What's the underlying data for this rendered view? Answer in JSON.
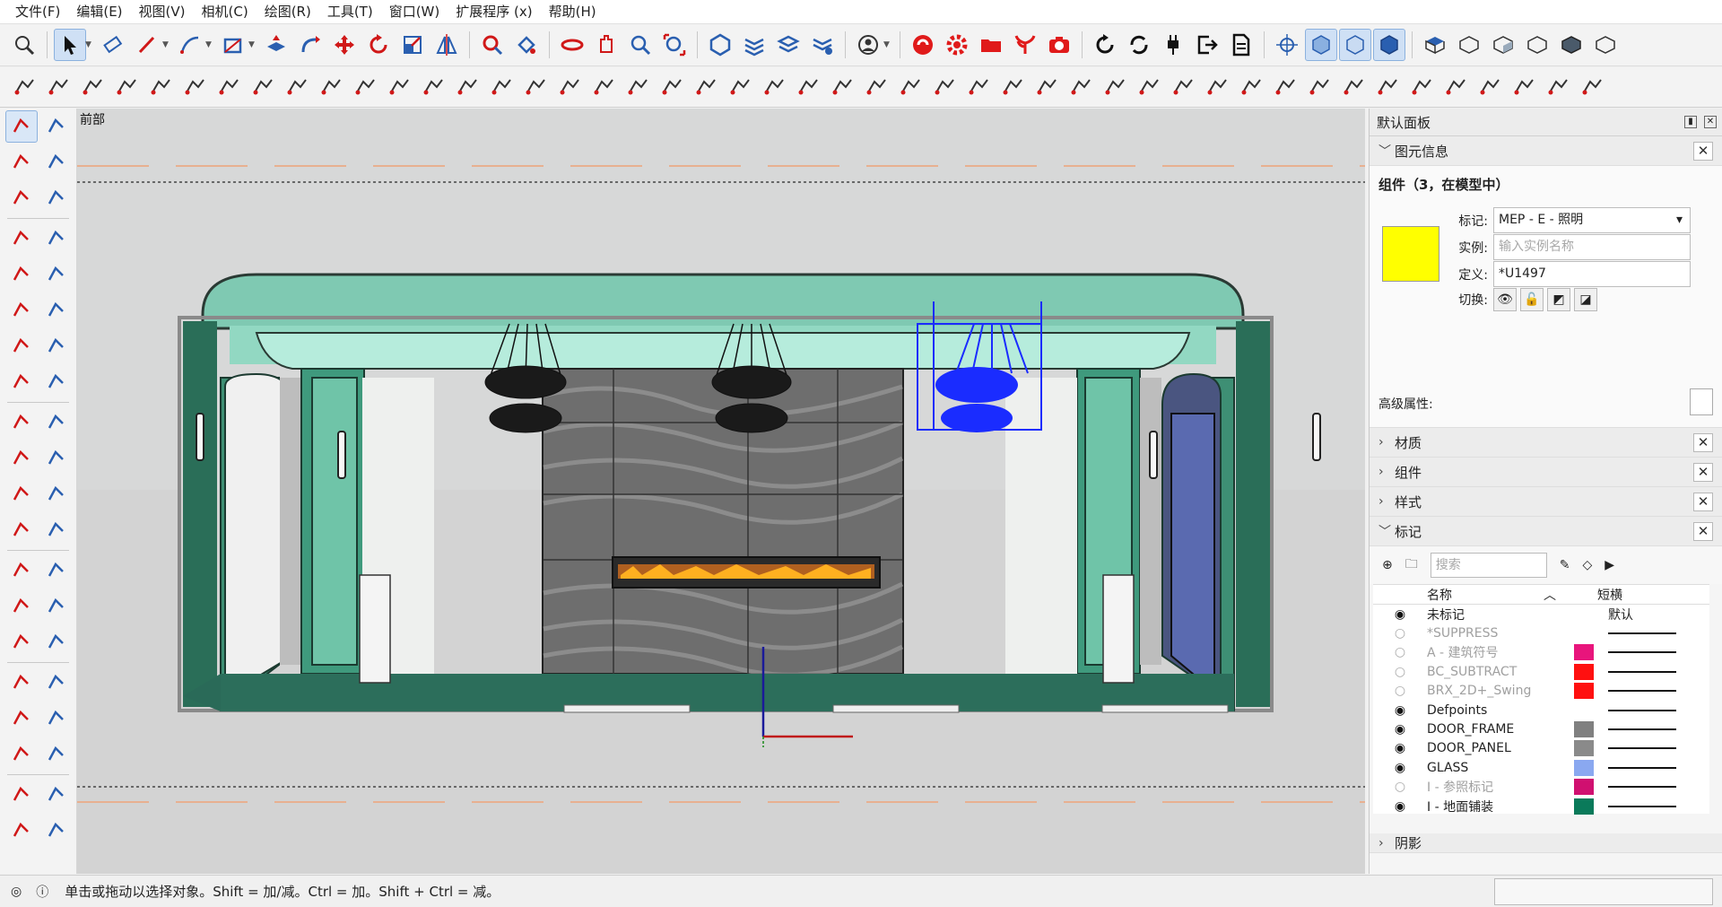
{
  "menu": [
    "文件(F)",
    "编辑(E)",
    "视图(V)",
    "相机(C)",
    "绘图(R)",
    "工具(T)",
    "窗口(W)",
    "扩展程序 (x)",
    "帮助(H)"
  ],
  "scene": {
    "label": "前部"
  },
  "tray": {
    "title": "默认面板",
    "entity_info": {
      "header": "图元信息",
      "title": "组件（3，在模型中）",
      "swatch_color": "#ffff00",
      "tag_label": "标记:",
      "tag_value": "MEP - E - 照明",
      "instance_label": "实例:",
      "instance_placeholder": "输入实例名称",
      "definition_label": "定义:",
      "definition_value": "*U1497",
      "toggle_label": "切换:",
      "advanced_label": "高级属性:"
    },
    "sections": [
      "材质",
      "组件",
      "样式"
    ],
    "tags": {
      "header": "标记",
      "search_placeholder": "搜索",
      "col_name": "名称",
      "col_dash": "短横",
      "rows": [
        {
          "name": "未标记",
          "visible": true,
          "dim": false,
          "color": "",
          "dash": "默认"
        },
        {
          "name": "*SUPPRESS",
          "visible": false,
          "dim": true,
          "color": "",
          "dash": ""
        },
        {
          "name": "A - 建筑符号",
          "visible": false,
          "dim": true,
          "color": "#e8157c",
          "dash": ""
        },
        {
          "name": "BC_SUBTRACT",
          "visible": false,
          "dim": true,
          "color": "#ff1010",
          "dash": ""
        },
        {
          "name": "BRX_2D+_Swing",
          "visible": false,
          "dim": true,
          "color": "#ff1010",
          "dash": ""
        },
        {
          "name": "Defpoints",
          "visible": true,
          "dim": false,
          "color": "",
          "dash": ""
        },
        {
          "name": "DOOR_FRAME",
          "visible": true,
          "dim": false,
          "color": "#808080",
          "dash": ""
        },
        {
          "name": "DOOR_PANEL",
          "visible": true,
          "dim": false,
          "color": "#8a8a8a",
          "dash": ""
        },
        {
          "name": "GLASS",
          "visible": true,
          "dim": false,
          "color": "#8aa8f0",
          "dash": ""
        },
        {
          "name": "I - 参照标记",
          "visible": false,
          "dim": true,
          "color": "#d01070",
          "dash": ""
        },
        {
          "name": "I - 地面铺装",
          "visible": true,
          "dim": false,
          "color": "#0a7a5a",
          "dash": ""
        }
      ]
    },
    "bottom_section": "阴影"
  },
  "status": {
    "text": "单击或拖动以选择对象。Shift = 加/减。Ctrl = 加。Shift + Ctrl = 减。"
  }
}
